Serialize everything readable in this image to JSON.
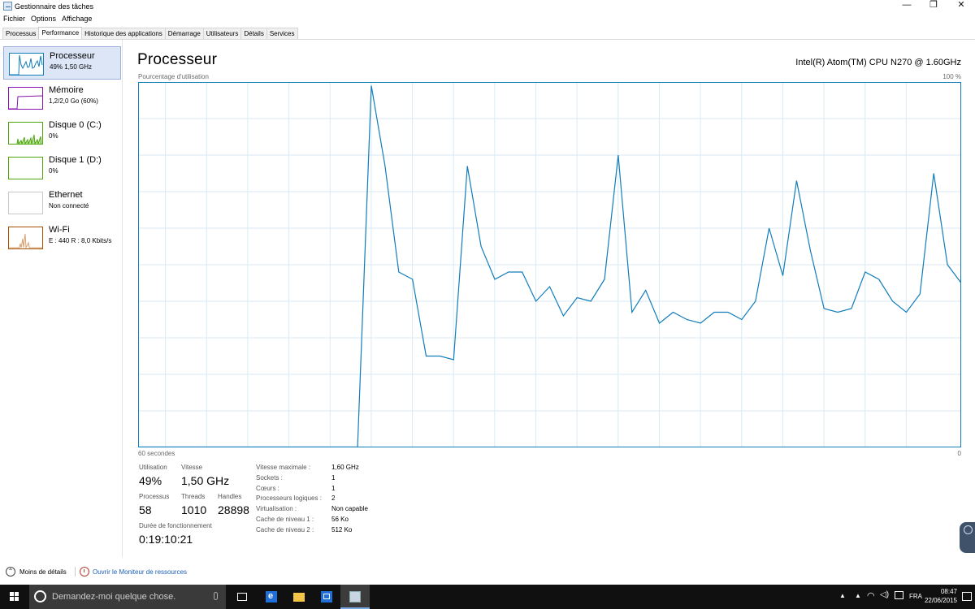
{
  "window": {
    "title": "Gestionnaire des tâches",
    "controls": {
      "minimize": "—",
      "maximize": "❐",
      "close": "✕"
    }
  },
  "menu": [
    "Fichier",
    "Options",
    "Affichage"
  ],
  "tabs": [
    "Processus",
    "Performance",
    "Historique des applications",
    "Démarrage",
    "Utilisateurs",
    "Détails",
    "Services"
  ],
  "active_tab": "Performance",
  "sidebar": {
    "items": [
      {
        "title": "Processeur",
        "sub": "49% 1,50 GHz",
        "color": "#117dbb",
        "selected": true
      },
      {
        "title": "Mémoire",
        "sub": "1,2/2,0 Go (60%)",
        "color": "#8b12ae",
        "selected": false
      },
      {
        "title": "Disque 0 (C:)",
        "sub": "0%",
        "color": "#4da60c",
        "selected": false
      },
      {
        "title": "Disque 1 (D:)",
        "sub": "0%",
        "color": "#4da60c",
        "selected": false
      },
      {
        "title": "Ethernet",
        "sub": "Non connecté",
        "color": "#a74f01",
        "selected": false
      },
      {
        "title": "Wi-Fi",
        "sub": "E : 440 R : 8,0 Kbits/s",
        "color": "#a74f01",
        "selected": false
      }
    ]
  },
  "main": {
    "title": "Processeur",
    "cpu_name": "Intel(R) Atom(TM) CPU N270 @ 1.60GHz",
    "graph_label": "Pourcentage d'utilisation",
    "graph_max": "100 %",
    "axis_left": "60 secondes",
    "axis_right": "0"
  },
  "chart_data": {
    "type": "line",
    "ylim": [
      0,
      100
    ],
    "xlim": [
      60,
      0
    ],
    "grid": true,
    "color": "#117dbb",
    "x": [
      60,
      59,
      58,
      57,
      56,
      55,
      54,
      53,
      52,
      51,
      50,
      49,
      48,
      47,
      46,
      45,
      44,
      43,
      42,
      41,
      40,
      39,
      38,
      37,
      36,
      35,
      34,
      33,
      32,
      31,
      30,
      29,
      28,
      27,
      26,
      25,
      24,
      23,
      22,
      21,
      20,
      19,
      18,
      17,
      16,
      15,
      14,
      13,
      12,
      11,
      10,
      9,
      8,
      7,
      6,
      5,
      4,
      3,
      2,
      1,
      0
    ],
    "values": [
      0,
      0,
      0,
      0,
      0,
      0,
      0,
      0,
      0,
      0,
      0,
      0,
      0,
      0,
      0,
      0,
      0,
      99,
      77,
      48,
      46,
      25,
      25,
      24,
      77,
      55,
      46,
      48,
      48,
      40,
      44,
      36,
      41,
      40,
      46,
      80,
      37,
      43,
      34,
      37,
      35,
      34,
      37,
      37,
      35,
      40,
      60,
      47,
      73,
      54,
      38,
      37,
      38,
      48,
      46,
      40,
      37,
      42,
      75,
      50,
      45
    ],
    "units": "%"
  },
  "stats": {
    "utilisation": {
      "label": "Utilisation",
      "value": "49%"
    },
    "vitesse": {
      "label": "Vitesse",
      "value": "1,50 GHz"
    },
    "processus": {
      "label": "Processus",
      "value": "58"
    },
    "threads": {
      "label": "Threads",
      "value": "1010"
    },
    "handles": {
      "label": "Handles",
      "value": "28898"
    },
    "uptime": {
      "label": "Durée de fonctionnement",
      "value": "0:19:10:21"
    }
  },
  "specs": [
    {
      "label": "Vitesse maximale :",
      "value": "1,60 GHz"
    },
    {
      "label": "Sockets :",
      "value": "1"
    },
    {
      "label": "Cœurs :",
      "value": "1"
    },
    {
      "label": "Processeurs logiques :",
      "value": "2"
    },
    {
      "label": "Virtualisation :",
      "value": "Non capable"
    },
    {
      "label": "Cache de niveau 1 :",
      "value": "56 Ko"
    },
    {
      "label": "Cache de niveau 2 :",
      "value": "512 Ko"
    }
  ],
  "footer": {
    "less_details": "Moins de détails",
    "resource_monitor": "Ouvrir le Moniteur de ressources"
  },
  "taskbar": {
    "search_placeholder": "Demandez-moi quelque chose.",
    "language": "FRA",
    "time": "08:47",
    "date": "22/06/2015"
  }
}
